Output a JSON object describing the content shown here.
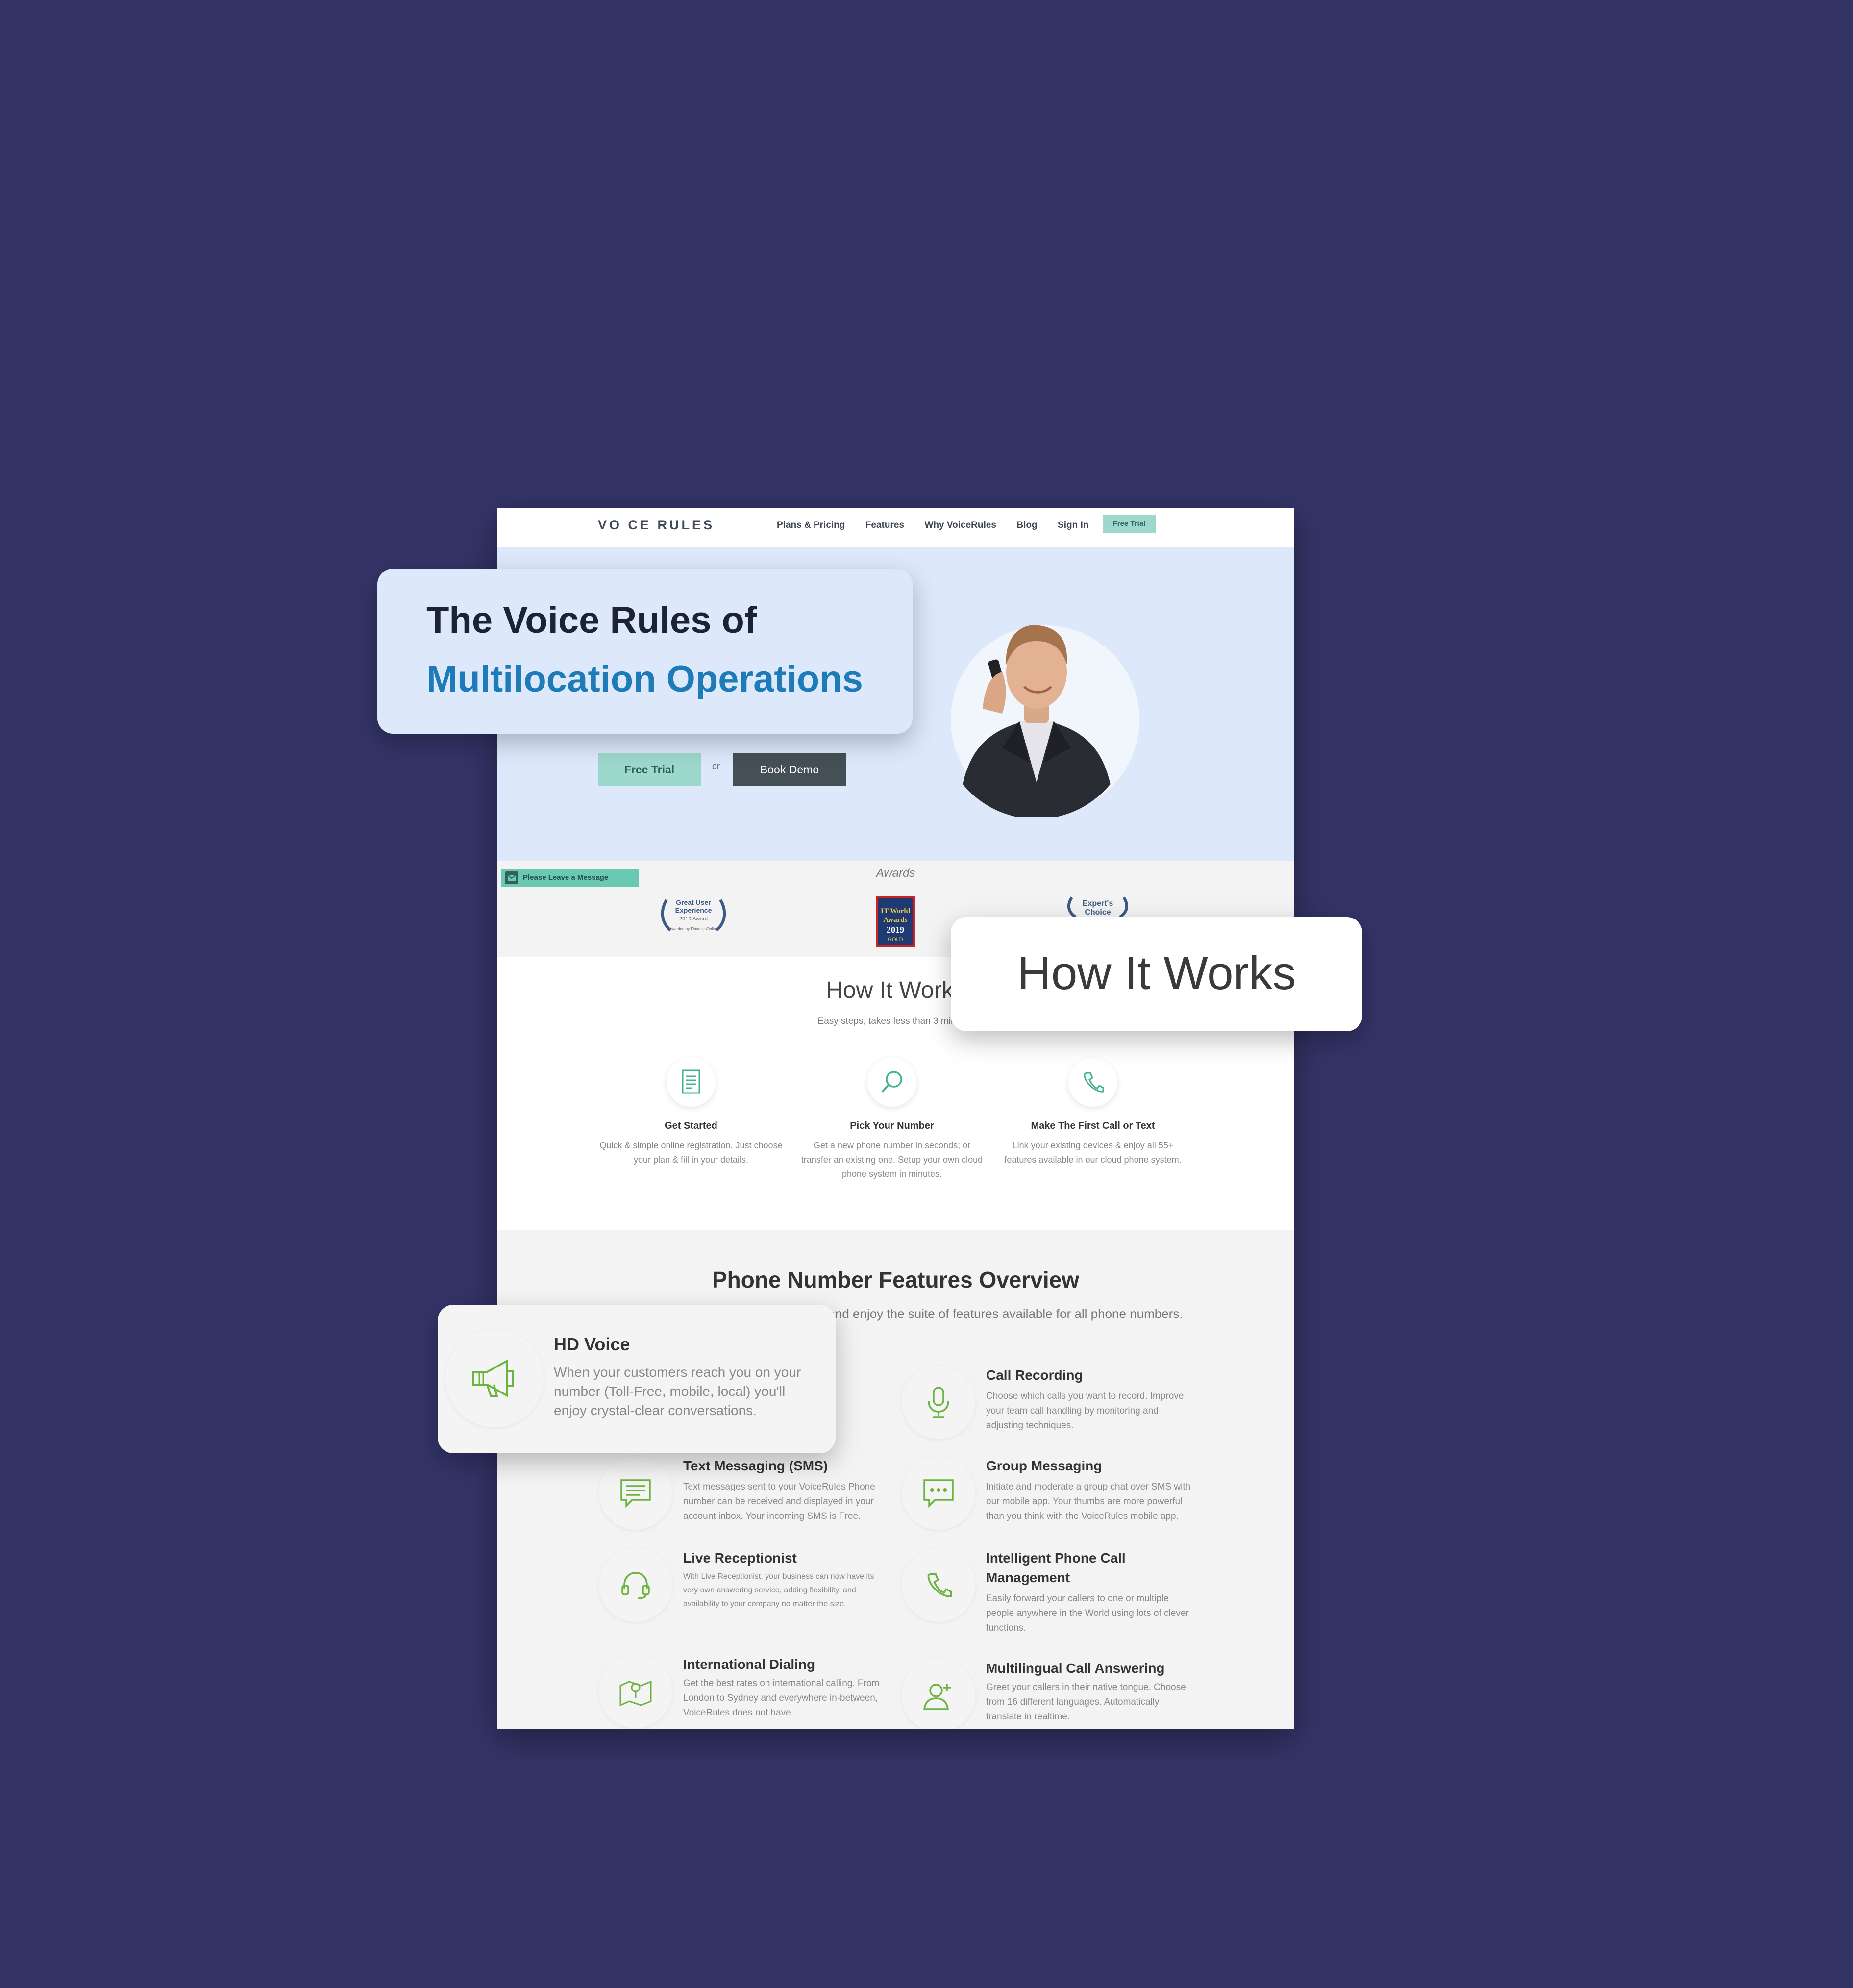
{
  "nav": {
    "logo": "VO CE RULES",
    "links": [
      "Plans & Pricing",
      "Features",
      "Why VoiceRules",
      "Blog",
      "Sign In"
    ],
    "cta": "Free Trial"
  },
  "hero": {
    "primary_button": "Free Trial",
    "or_text": "or",
    "secondary_button": "Book Demo"
  },
  "message_tab": "Please Leave a Message",
  "awards": {
    "title": "Awards",
    "items": [
      {
        "l1": "Great User",
        "l2": "Experience",
        "l3": "2019 Award",
        "l4": "Awarded by FinancesOnline"
      },
      {
        "l1": "IT World",
        "l2": "Awards",
        "l3": "2019",
        "l4": "GOLD"
      },
      {
        "l1": "Expert's",
        "l2": "Choice"
      }
    ]
  },
  "how_it_works": {
    "title": "How It Works",
    "subtitle": "Easy steps, takes less than 3 minutes",
    "steps": [
      {
        "title": "Get Started",
        "text": "Quick & simple online registration. Just choose your plan & fill in your details.",
        "icon": "document-icon"
      },
      {
        "title": "Pick Your Number",
        "text": "Get a new phone number in seconds; or transfer an existing one. Setup your own cloud phone system in minutes.",
        "icon": "search-icon"
      },
      {
        "title": "Make The First Call or Text",
        "text": "Link your existing devices & enjoy all 55+ features available in our cloud phone system.",
        "icon": "phone-icon"
      }
    ]
  },
  "features": {
    "title": "Phone Number Features Overview",
    "subtitle": "Provide customers a way to reach you and enjoy the suite of features available for all phone numbers.",
    "items": [
      {
        "name": "Call Recording",
        "desc": "Choose which calls you want to record. Improve your team call handling by monitoring and adjusting techniques.",
        "icon": "microphone-icon"
      },
      {
        "name": "Text Messaging (SMS)",
        "desc": "Text messages sent to your VoiceRules Phone number can be received and displayed in your account inbox. Your incoming SMS is Free.",
        "icon": "message-icon"
      },
      {
        "name": "Group Messaging",
        "desc": "Initiate and moderate a group chat over SMS with our mobile app. Your thumbs are more powerful than you think with the VoiceRules mobile app.",
        "icon": "chat-icon"
      },
      {
        "name": "Live Receptionist",
        "desc": "With Live Receptionist, your business can now have its very own answering service, adding flexibility, and availability to your company no matter the size.",
        "icon": "headset-icon"
      },
      {
        "name": "Intelligent Phone Call Management",
        "desc": "Easily forward your callers to one or multiple people anywhere in the World using lots of clever functions.",
        "icon": "phone-icon"
      },
      {
        "name": "International Dialing",
        "desc": "Get the best rates on international calling. From London to Sydney and everywhere in-between, VoiceRules does not have",
        "icon": "map-icon"
      },
      {
        "name": "Multilingual Call Answering",
        "desc": "Greet your callers in their native tongue. Choose from 16 different languages. Automatically translate in realtime.",
        "icon": "add-user-icon"
      }
    ]
  },
  "overlays": {
    "headline_line1": "The Voice Rules of",
    "headline_line2": "Multilocation Operations",
    "how_it_works": "How It Works",
    "hd_voice_title": "HD Voice",
    "hd_voice_desc": "When your customers reach you on your number (Toll-Free, mobile, local) you'll enjoy crystal-clear conversations."
  },
  "colors": {
    "background": "#333366",
    "accent_teal": "#9dd8cc",
    "brand_blue": "#1d7bb8",
    "hero_bg": "#dde9fb",
    "icon_green": "#6db33f"
  }
}
